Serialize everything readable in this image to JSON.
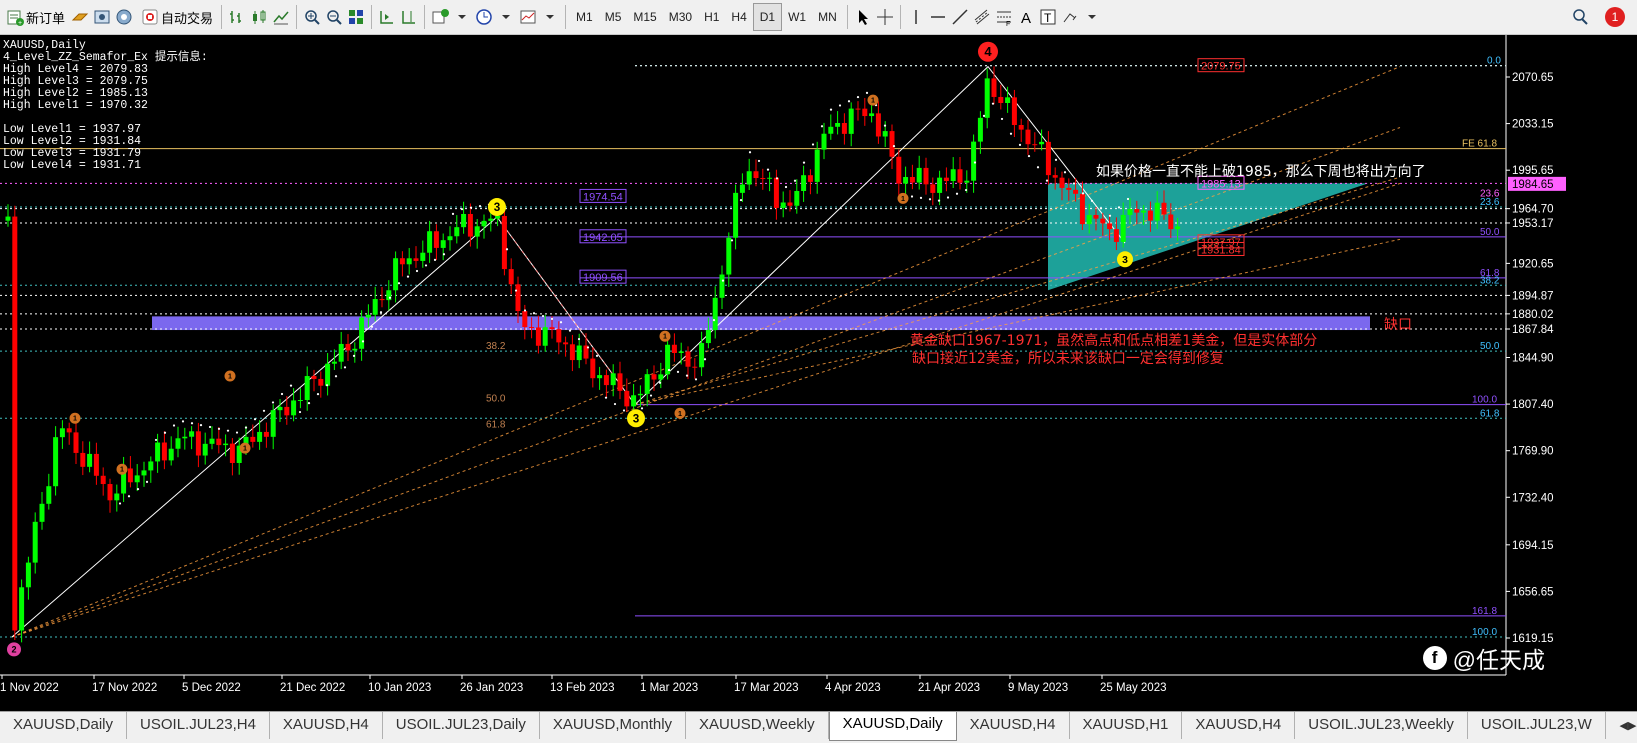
{
  "toolbar": {
    "new_order": "新订单",
    "auto_trading": "自动交易",
    "timeframes": [
      "M1",
      "M5",
      "M15",
      "M30",
      "H1",
      "H4",
      "D1",
      "W1",
      "MN"
    ],
    "active_timeframe": "D1",
    "notification_count": "1"
  },
  "chart": {
    "symbol": "XAUUSD,Daily",
    "indicator": "4_Level_ZZ_Semafor_Ex 提示信息:",
    "levels": [
      "High Level4 = 2079.83",
      "High Level3 = 2079.75",
      "High Level2 = 1985.13",
      "High Level1 = 1970.32",
      "",
      "Low Level1 = 1937.97",
      "Low Level2 = 1931.84",
      "Low Level3 = 1931.79",
      "Low Level4 = 1931.71"
    ],
    "price_labels": [
      "2070.65",
      "2033.15",
      "1995.65",
      "1964.70",
      "1953.17",
      "1920.65",
      "1894.87",
      "1880.02",
      "1867.84",
      "1844.90",
      "1807.40",
      "1769.90",
      "1732.40",
      "1694.15",
      "1656.65",
      "1619.15"
    ],
    "current_price": "1984.65",
    "date_labels": [
      "1 Nov 2022",
      "17 Nov 2022",
      "5 Dec 2022",
      "21 Dec 2022",
      "10 Jan 2023",
      "26 Jan 2023",
      "13 Feb 2023",
      "1 Mar 2023",
      "17 Mar 2023",
      "4 Apr 2023",
      "21 Apr 2023",
      "9 May 2023",
      "25 May 2023"
    ],
    "boxed_labels": [
      "2079.75",
      "1985.13",
      "1974.54",
      "1942.05",
      "1909.56",
      "1937.97",
      "1931.84"
    ],
    "fib_labels": [
      "0.0",
      "FE 61.8",
      "23.6",
      "38.2",
      "50.0",
      "61.8",
      "38.2",
      "50.0",
      "100.0",
      "61.8",
      "161.8",
      "100.0",
      "38.2",
      "50.0",
      "61.8"
    ],
    "semafor_labels": [
      "4",
      "3",
      "3",
      "3",
      "2",
      "1"
    ],
    "gap_label": "缺口",
    "annotation_line1": "如果价格一直不能上破1985，那么下周也将出方向了",
    "annotation_line2": "黄金缺口1967-1971，虽然高点和低点相差1美金，但是实体部分",
    "annotation_line3": "缺口接近12美金，所以未来该缺口一定会得到修复",
    "watermark": "@任天成",
    "colors": {
      "bull": "#00ff00",
      "bear": "#ff0000",
      "triangle": "#20b2aa",
      "gap": "#7b68ee",
      "annotation": "#ff3030"
    }
  },
  "tabs": [
    "XAUUSD,Daily",
    "USOIL.JUL23,H4",
    "XAUUSD,H4",
    "USOIL.JUL23,Daily",
    "XAUUSD,Monthly",
    "XAUUSD,Weekly",
    "XAUUSD,Daily",
    "XAUUSD,H4",
    "XAUUSD,H1",
    "XAUUSD,H4",
    "USOIL.JUL23,Weekly",
    "USOIL.JUL23,W"
  ],
  "active_tab": 6
}
